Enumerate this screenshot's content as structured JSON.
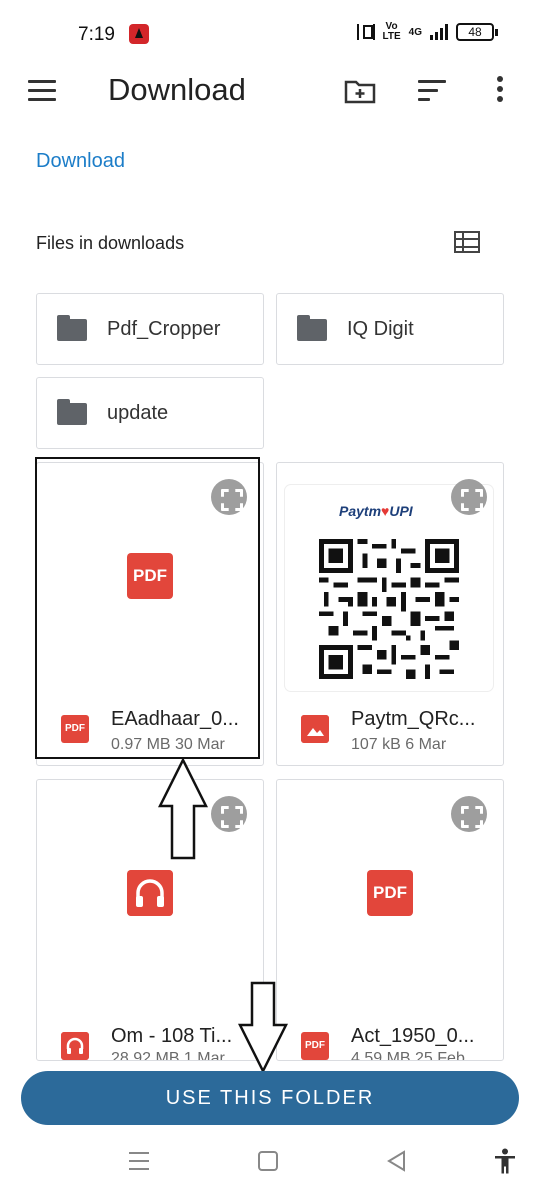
{
  "status_bar": {
    "time": "7:19",
    "volte": "Vo\nLTE",
    "network": "4G",
    "battery": "48"
  },
  "toolbar": {
    "title": "Download"
  },
  "breadcrumb": "Download",
  "section_label": "Files in downloads",
  "folders": [
    {
      "name": "Pdf_Cropper"
    },
    {
      "name": "IQ Digit"
    },
    {
      "name": "update"
    }
  ],
  "files": [
    {
      "name": "EAadhaar_0...",
      "info": "0.97 MB 30 Mar",
      "type": "pdf",
      "type_label": "PDF"
    },
    {
      "name": "Paytm_QRc...",
      "info": "107 kB 6 Mar",
      "type": "image",
      "upi_brand": "Paytm",
      "upi_text": "UPI"
    },
    {
      "name": "Om - 108 Ti...",
      "info": "28.92 MB 1 Mar",
      "type": "audio"
    },
    {
      "name": "Act_1950_0...",
      "info": "4.59 MB 25 Feb",
      "type": "pdf",
      "type_label": "PDF"
    }
  ],
  "cta": {
    "label": "USE THIS FOLDER"
  },
  "colors": {
    "accent": "#2c6a9a",
    "link": "#1c7dc8",
    "pdf_red": "#e2463b"
  }
}
